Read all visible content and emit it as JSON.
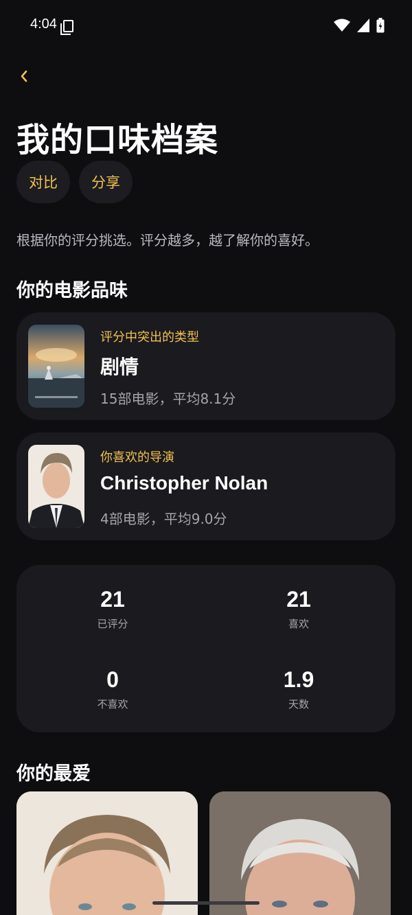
{
  "status_bar": {
    "time": "4:04"
  },
  "header": {
    "back_icon": "chevron-left-icon",
    "title": "我的口味档案"
  },
  "actions": {
    "compare": "对比",
    "share": "分享"
  },
  "description": "根据你的评分挑选。评分越多，越了解你的喜好。",
  "taste": {
    "title": "你的电影品味",
    "genre": {
      "kicker": "评分中突出的类型",
      "name": "剧情",
      "meta": "15部电影，平均8.1分"
    },
    "director": {
      "kicker": "你喜欢的导演",
      "name": "Christopher Nolan",
      "meta": "4部电影，平均9.0分"
    }
  },
  "stats": {
    "rated": {
      "value": "21",
      "label": "已评分"
    },
    "liked": {
      "value": "21",
      "label": "喜欢"
    },
    "disliked": {
      "value": "0",
      "label": "不喜欢"
    },
    "days": {
      "value": "1.9",
      "label": "天数"
    }
  },
  "favorites": {
    "title": "你的最爱"
  },
  "colors": {
    "accent": "#f2c14e",
    "background": "#0e0e11",
    "card": "#1a1a1f"
  }
}
